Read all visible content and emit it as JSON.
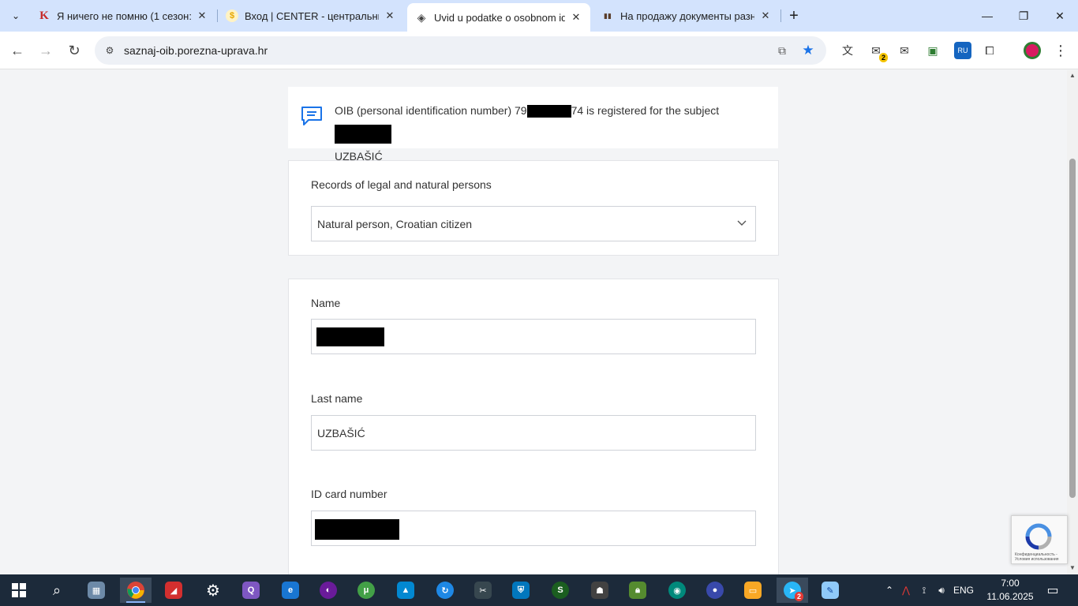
{
  "browser": {
    "tabs": [
      {
        "title": "Я ничего не помню (1 сезон: ",
        "favicon_letter": "K",
        "favicon_color": "#c62828",
        "active": false
      },
      {
        "title": "Вход | CENTER - центральный",
        "favicon_letter": "$",
        "favicon_color": "#e6a700",
        "active": false
      },
      {
        "title": "Uvid u podatke o osobnom ide",
        "favicon_letter": "◈",
        "favicon_color": "#444444",
        "active": true
      },
      {
        "title": "На продажу документы разны",
        "favicon_letter": "▮▮",
        "favicon_color": "#5a3e2b",
        "active": false
      }
    ],
    "url": "saznaj-oib.porezna-uprava.hr",
    "mail_badge": "2",
    "extension_badge": "RU"
  },
  "message": {
    "prefix": "OIB (personal identification number) 79",
    "suffix": "74 is registered for the subject",
    "surname": "UZBAŠIĆ"
  },
  "records": {
    "label": "Records of legal and natural persons",
    "selected": "Natural person, Croatian citizen"
  },
  "form": {
    "name_label": "Name",
    "lastname_label": "Last name",
    "lastname_value": "UZBAŠIĆ",
    "idcard_label": "ID card number"
  },
  "recaptcha": {
    "text": "Конфиденциальность - Условия использования"
  },
  "taskbar": {
    "telegram_badge": "2",
    "language": "ENG",
    "time": "7:00",
    "date": "11.06.2025"
  }
}
